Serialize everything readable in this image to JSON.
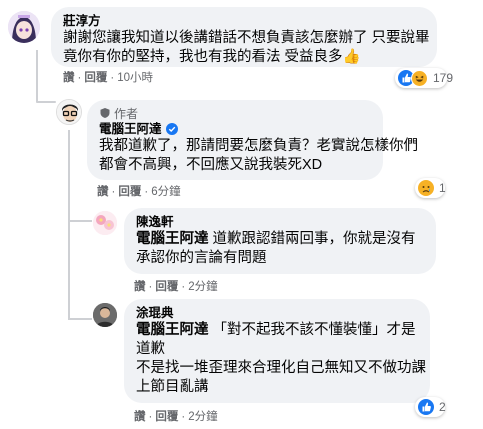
{
  "comments": [
    {
      "name": "莊淳方",
      "lines": [
        "謝謝您讓我知道以後講錯話不想負責該怎麼辦了 只要說畢",
        "竟你有你的堅持，我也有我的看法 受益良多"
      ],
      "emoji_tail": "👍",
      "actions": {
        "like": "讚",
        "reply": "回覆",
        "time": "10小時"
      },
      "reaction_count": "179"
    },
    {
      "author_tag": "作者",
      "name": "電腦王阿達",
      "lines": [
        "我都道歉了，那請問要怎麼負責？老實說怎樣你們",
        "都會不高興，不回應又說我裝死XD"
      ],
      "actions": {
        "like": "讚",
        "reply": "回覆",
        "time": "6分鐘"
      },
      "reaction_count": "1"
    },
    {
      "name": "陳逸軒",
      "mention": "電腦王阿達",
      "lines": [
        " 道歉跟認錯兩回事，你就是沒有",
        "承認你的言論有問題"
      ],
      "actions": {
        "like": "讚",
        "reply": "回覆",
        "time": "2分鐘"
      }
    },
    {
      "name": "涂琨典",
      "mention": "電腦王阿達",
      "lines": [
        " 「對不起我不該不懂裝懂」才是",
        "道歉",
        "不是找一堆歪理來合理化自己無知又不做功課",
        "上節目亂講"
      ],
      "actions": {
        "like": "讚",
        "reply": "回覆",
        "time": "2分鐘"
      },
      "reaction_count": "2"
    }
  ],
  "colors": {
    "bubble": "#f0f2f5",
    "meta_text": "#65676b",
    "like_blue": "#1877f2",
    "haha_yellow": "#f7b125",
    "verified_blue": "#1877f2"
  },
  "icons": [
    "like-reaction-icon",
    "haha-reaction-icon",
    "sad-reaction-icon",
    "verified-badge-icon",
    "author-shield-icon",
    "thumbs-up-emoji"
  ]
}
